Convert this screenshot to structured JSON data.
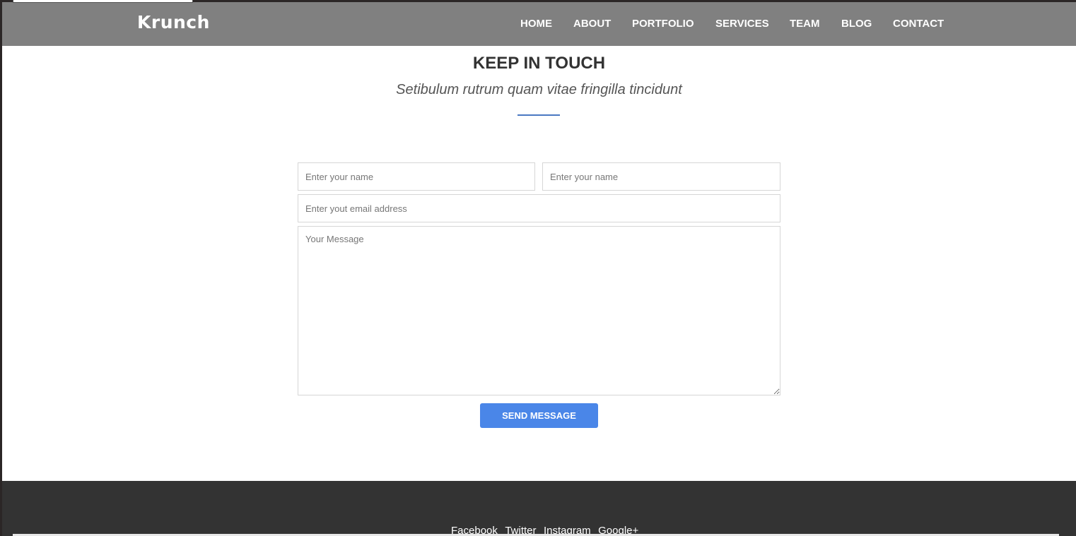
{
  "brand": "Krunch",
  "nav": [
    "HOME",
    "ABOUT",
    "PORTFOLIO",
    "SERVICES",
    "TEAM",
    "BLOG",
    "CONTACT"
  ],
  "contact": {
    "title": "KEEP IN TOUCH",
    "subtitle": "Setibulum rutrum quam vitae fringilla tincidunt",
    "first_name_placeholder": "Enter your name",
    "last_name_placeholder": "Enter your name",
    "email_placeholder": "Enter yout email address",
    "message_placeholder": "Your Message",
    "send_label": "SEND MESSAGE"
  },
  "footer": {
    "social": [
      "Facebook",
      "Twitter",
      "Instagram",
      "Google+"
    ]
  },
  "colors": {
    "nav_bg": "#808080",
    "accent": "#4a86e8",
    "footer_bg": "#333333"
  }
}
